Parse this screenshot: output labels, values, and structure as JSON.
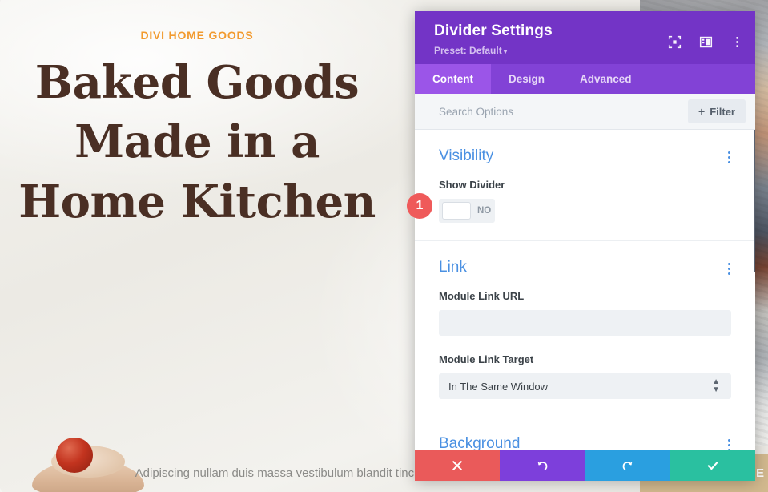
{
  "page": {
    "eyebrow": "DIVI HOME GOODS",
    "title_lines": [
      "Baked Goods",
      "Made in a",
      "Home Kitchen"
    ],
    "subtitle": "Adipiscing nullam duis massa vestibulum blandit tincidunt morbi",
    "shop_banner": "SHOP ONLINE",
    "accent_orange": "#f29a2e",
    "heading_brown": "#4a2f24",
    "banner_tan": "#d2b98e"
  },
  "step_badge": {
    "number": "1",
    "color": "#ef5a5a"
  },
  "modal": {
    "title": "Divider Settings",
    "preset": "Preset: Default",
    "preset_caret": "▾",
    "header_icons": [
      {
        "name": "focus-icon"
      },
      {
        "name": "panel-layout-icon"
      },
      {
        "name": "more-options-icon"
      }
    ],
    "tabs": [
      {
        "label": "Content",
        "active": true
      },
      {
        "label": "Design",
        "active": false
      },
      {
        "label": "Advanced",
        "active": false
      }
    ],
    "search": {
      "placeholder": "Search Options",
      "value": ""
    },
    "filter_button": {
      "plus": "+",
      "label": "Filter"
    },
    "sections": [
      {
        "title": "Visibility",
        "fields": [
          {
            "label": "Show Divider",
            "type": "toggle",
            "value": "NO"
          }
        ]
      },
      {
        "title": "Link",
        "fields": [
          {
            "label": "Module Link URL",
            "type": "text",
            "value": "",
            "placeholder": ""
          },
          {
            "label": "Module Link Target",
            "type": "select",
            "value": "In The Same Window"
          }
        ]
      },
      {
        "title": "Background",
        "fields": []
      }
    ],
    "header_bg": "#7334c6",
    "tabbar_bg": "#8242d6",
    "tab_active_bg": "#9b55e8",
    "section_title_color": "#4a90e2"
  },
  "action_bar": {
    "buttons": [
      {
        "name": "cancel-button",
        "icon": "close-icon",
        "color": "#ea5a5a"
      },
      {
        "name": "undo-button",
        "icon": "undo-icon",
        "color": "#7d3fdb"
      },
      {
        "name": "redo-button",
        "icon": "redo-icon",
        "color": "#2a9fe0"
      },
      {
        "name": "save-button",
        "icon": "check-icon",
        "color": "#2ac0a0"
      }
    ]
  },
  "scrollbar": {
    "name": "modal-scrollbar"
  }
}
